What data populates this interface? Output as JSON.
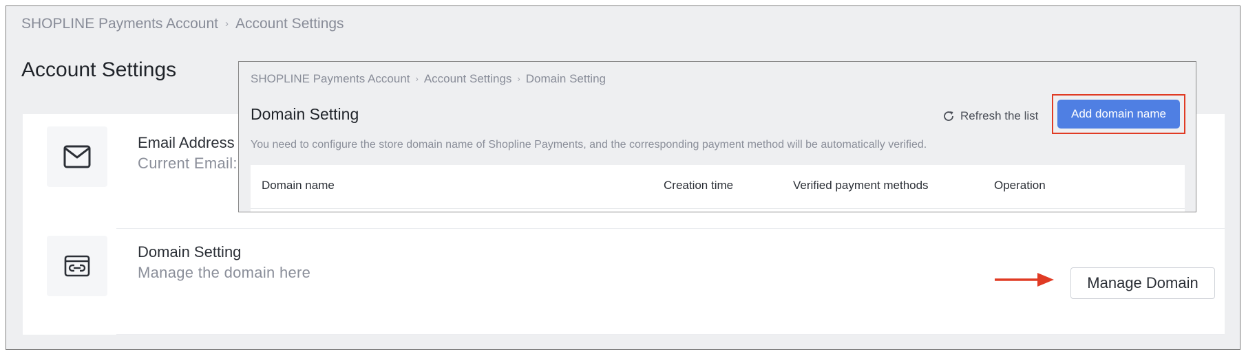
{
  "breadcrumb": [
    "SHOPLINE Payments Account",
    "Account Settings"
  ],
  "page_title": "Account Settings",
  "email_row": {
    "icon": "mail-icon",
    "title": "Email Address",
    "subtitle": "Current Email:"
  },
  "domain_row": {
    "icon": "domain-link-icon",
    "title": "Domain Setting",
    "subtitle": "Manage the domain here",
    "button_label": "Manage Domain"
  },
  "domain_panel": {
    "breadcrumb": [
      "SHOPLINE Payments Account",
      "Account Settings",
      "Domain Setting"
    ],
    "title": "Domain Setting",
    "refresh_label": "Refresh the list",
    "add_button_label": "Add domain name",
    "description": "You need to configure the store domain name of Shopline Payments, and the corresponding payment method will be automatically verified.",
    "table_headers": [
      "Domain name",
      "Creation time",
      "Verified payment methods",
      "Operation"
    ]
  },
  "colors": {
    "primary": "#4f7fe3",
    "annotation": "#e03b24",
    "background": "#eeeff1"
  }
}
